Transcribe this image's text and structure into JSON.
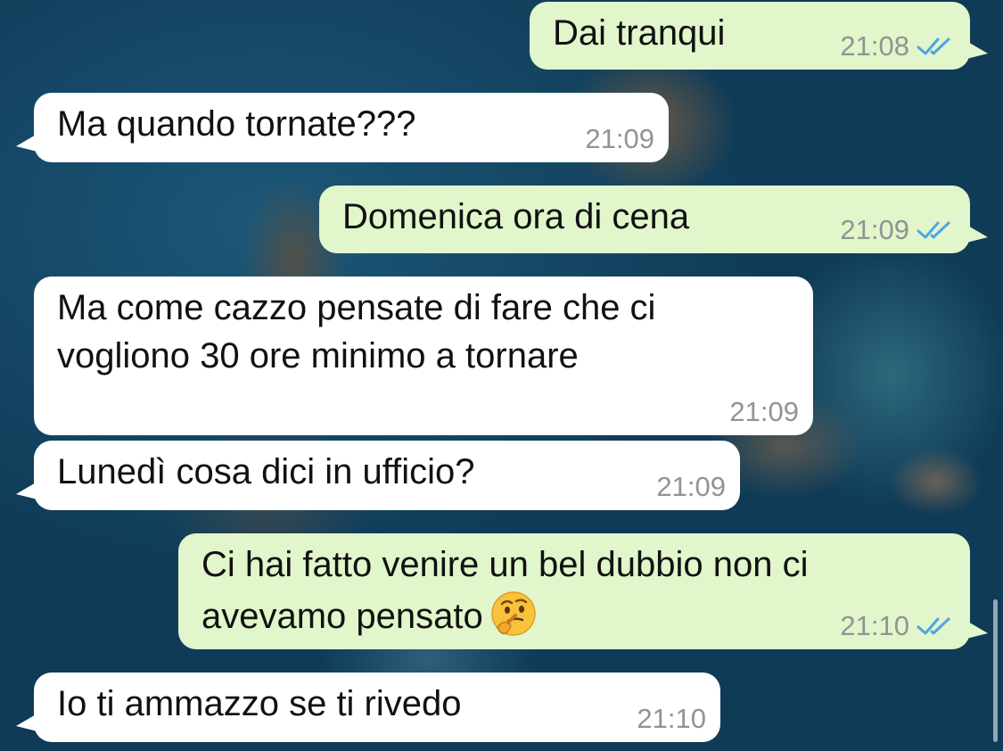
{
  "colors": {
    "incoming_bubble": "#ffffff",
    "outgoing_bubble": "#e1f6cb",
    "timestamp": "#939393",
    "read_receipt": "#4fa3e8"
  },
  "messages": [
    {
      "direction": "outgoing",
      "text": "Dai tranqui",
      "time": "21:08",
      "status": "read",
      "status_icon": "double-check-icon"
    },
    {
      "direction": "incoming",
      "text": "Ma quando tornate???",
      "time": "21:09"
    },
    {
      "direction": "outgoing",
      "text": "Domenica ora di cena",
      "time": "21:09",
      "status": "read",
      "status_icon": "double-check-icon"
    },
    {
      "direction": "incoming",
      "line1": "Ma come cazzo pensate di fare che ci",
      "line2": "vogliono 30 ore minimo a tornare",
      "time": "21:09"
    },
    {
      "direction": "incoming",
      "text": "Lunedì cosa dici in ufficio?",
      "time": "21:09"
    },
    {
      "direction": "outgoing",
      "line1": "Ci hai fatto venire un bel dubbio non ci",
      "line2": "avevamo pensato",
      "emoji": "thinking-face-icon",
      "time": "21:10",
      "status": "read",
      "status_icon": "double-check-icon"
    },
    {
      "direction": "incoming",
      "text": "Io ti ammazzo se ti rivedo",
      "time": "21:10"
    }
  ]
}
